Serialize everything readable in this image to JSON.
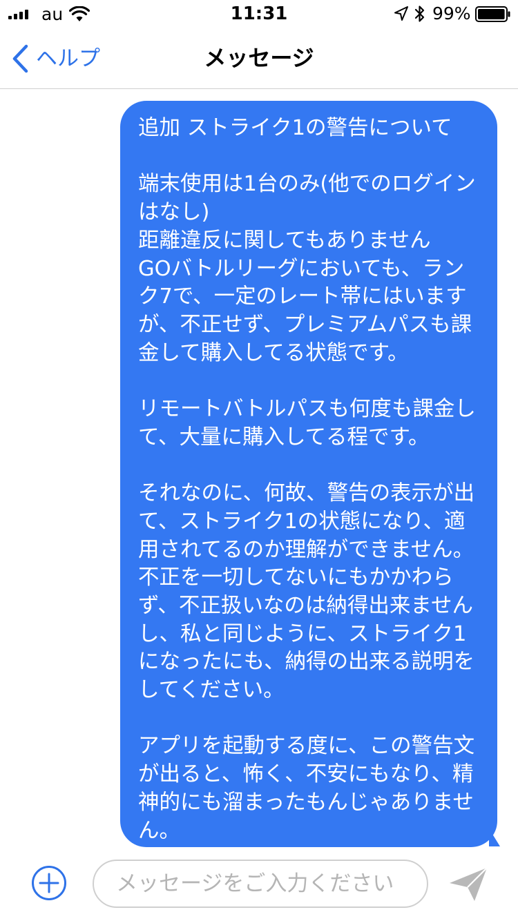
{
  "status_bar": {
    "carrier": "au",
    "time": "11:31",
    "battery_percent": "99%",
    "battery_level": 0.99,
    "signal_bars": 4,
    "icons": [
      "signal-icon",
      "wifi-icon",
      "location-icon",
      "bluetooth-icon",
      "battery-icon"
    ]
  },
  "nav": {
    "back_label": "ヘルプ",
    "title": "メッセージ"
  },
  "conversation": {
    "messages": [
      {
        "sender": "user",
        "text": "追加 ストライク1の警告について\n\n端末使用は1台のみ(他でのログインはなし)\n距離違反に関してもありません\nGOバトルリーグにおいても、ランク7で、一定のレート帯にはいますが、不正せず、プレミアムパスも課金して購入してる状態です。\n\nリモートバトルパスも何度も課金して、大量に購入してる程です。\n\nそれなのに、何故、警告の表示が出て、ストライク1の状態になり、適用されてるのか理解ができません。不正を一切してないにもかかわらず、不正扱いなのは納得出来ませんし、私と同じように、ストライク1になったにも、納得の出来る説明をしてください。\n\nアプリを起動する度に、この警告文が出ると、怖く、不安にもなり、精神的にも溜まったもんじゃありません。"
      }
    ]
  },
  "input": {
    "placeholder": "メッセージをご入力ください",
    "value": ""
  },
  "colors": {
    "accent": "#2e72e8",
    "bubble": "#3478f2",
    "bubble_text": "#ffffff",
    "divider": "#cfcfcf",
    "placeholder": "#b5b5b5",
    "send_icon": "#b8b8b8"
  }
}
